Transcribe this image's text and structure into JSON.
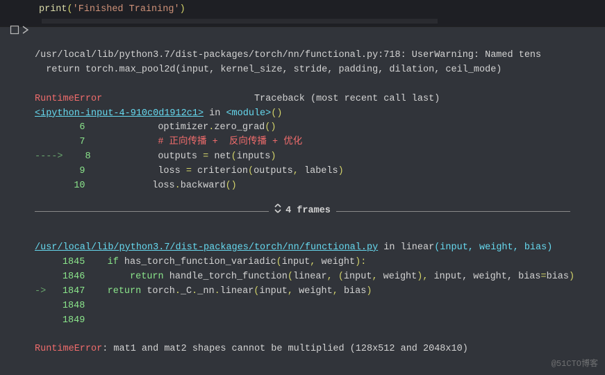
{
  "input_cell": {
    "tokens": {
      "print": "print",
      "string": "'Finished  Training'"
    }
  },
  "output": {
    "warning_line": "/usr/local/lib/python3.7/dist-packages/torch/nn/functional.py:718: UserWarning: Named tens",
    "warning_return": "  return torch.max_pool2d(input, kernel_size, stride, padding, dilation, ceil_mode)",
    "runtime_error_label": "RuntimeError",
    "traceback_label": "                           Traceback (most recent call last)",
    "ipython_link": "<ipython-input-4-910c0d1912c1>",
    "in_module": " in ",
    "module_angle": "<module>",
    "paren_empty": "()",
    "lines_block1": [
      {
        "ln": "6",
        "arrow": "     ",
        "tokens": [
          {
            "cls": "plain",
            "t": "        optimizer"
          },
          {
            "cls": "yellow",
            "t": "."
          },
          {
            "cls": "plain",
            "t": "zero_grad"
          },
          {
            "cls": "yellow",
            "t": "()"
          }
        ]
      },
      {
        "ln": "7",
        "arrow": "     ",
        "tokens": [
          {
            "cls": "plain",
            "t": "        "
          },
          {
            "cls": "red",
            "t": "# 正向传播 +  反向传播 + 优化"
          }
        ]
      },
      {
        "ln": "8",
        "arrow": "----> ",
        "tokens": [
          {
            "cls": "plain",
            "t": "       outputs "
          },
          {
            "cls": "yellow",
            "t": "="
          },
          {
            "cls": "plain",
            "t": " net"
          },
          {
            "cls": "yellow",
            "t": "("
          },
          {
            "cls": "plain",
            "t": "inputs"
          },
          {
            "cls": "yellow",
            "t": ")"
          }
        ]
      },
      {
        "ln": "9",
        "arrow": "     ",
        "tokens": [
          {
            "cls": "plain",
            "t": "        loss "
          },
          {
            "cls": "yellow",
            "t": "="
          },
          {
            "cls": "plain",
            "t": " criterion"
          },
          {
            "cls": "yellow",
            "t": "("
          },
          {
            "cls": "plain",
            "t": "outputs"
          },
          {
            "cls": "yellow",
            "t": ","
          },
          {
            "cls": "plain",
            "t": " labels"
          },
          {
            "cls": "yellow",
            "t": ")"
          }
        ]
      },
      {
        "ln": "10",
        "arrow": "     ",
        "tokens": [
          {
            "cls": "plain",
            "t": "       loss"
          },
          {
            "cls": "yellow",
            "t": "."
          },
          {
            "cls": "plain",
            "t": "backward"
          },
          {
            "cls": "yellow",
            "t": "()"
          }
        ]
      }
    ],
    "frames_sep": "4 frames",
    "functional_link": "/usr/local/lib/python3.7/dist-packages/torch/nn/functional.py",
    "in_linear": " in linear",
    "linear_args": "(input, weight, bias)",
    "lines_block2": [
      {
        "ln": "1845",
        "arrow": "   ",
        "tokens": [
          {
            "cls": "plain",
            "t": "   "
          },
          {
            "cls": "green",
            "t": "if"
          },
          {
            "cls": "plain",
            "t": " has_torch_function_variadic"
          },
          {
            "cls": "yellow",
            "t": "("
          },
          {
            "cls": "plain",
            "t": "input"
          },
          {
            "cls": "yellow",
            "t": ","
          },
          {
            "cls": "plain",
            "t": " weight"
          },
          {
            "cls": "yellow",
            "t": "):"
          }
        ]
      },
      {
        "ln": "1846",
        "arrow": "   ",
        "tokens": [
          {
            "cls": "plain",
            "t": "       "
          },
          {
            "cls": "green",
            "t": "return"
          },
          {
            "cls": "plain",
            "t": " handle_torch_function"
          },
          {
            "cls": "yellow",
            "t": "("
          },
          {
            "cls": "plain",
            "t": "linear"
          },
          {
            "cls": "yellow",
            "t": ","
          },
          {
            "cls": "plain",
            "t": " "
          },
          {
            "cls": "yellow",
            "t": "("
          },
          {
            "cls": "plain",
            "t": "input"
          },
          {
            "cls": "yellow",
            "t": ","
          },
          {
            "cls": "plain",
            "t": " weight"
          },
          {
            "cls": "yellow",
            "t": "),"
          },
          {
            "cls": "plain",
            "t": " input, weight, bias"
          },
          {
            "cls": "yellow",
            "t": "="
          },
          {
            "cls": "plain",
            "t": "bias"
          },
          {
            "cls": "yellow",
            "t": ")"
          }
        ]
      },
      {
        "ln": "1847",
        "arrow": "-> ",
        "tokens": [
          {
            "cls": "plain",
            "t": "   "
          },
          {
            "cls": "green",
            "t": "return"
          },
          {
            "cls": "plain",
            "t": " torch"
          },
          {
            "cls": "yellow",
            "t": "."
          },
          {
            "cls": "plain",
            "t": "_C"
          },
          {
            "cls": "yellow",
            "t": "."
          },
          {
            "cls": "plain",
            "t": "_nn"
          },
          {
            "cls": "yellow",
            "t": "."
          },
          {
            "cls": "plain",
            "t": "linear"
          },
          {
            "cls": "yellow",
            "t": "("
          },
          {
            "cls": "plain",
            "t": "input"
          },
          {
            "cls": "yellow",
            "t": ","
          },
          {
            "cls": "plain",
            "t": " weight"
          },
          {
            "cls": "yellow",
            "t": ","
          },
          {
            "cls": "plain",
            "t": " bias"
          },
          {
            "cls": "yellow",
            "t": ")"
          }
        ]
      },
      {
        "ln": "1848",
        "arrow": "   ",
        "tokens": []
      },
      {
        "ln": "1849",
        "arrow": "   ",
        "tokens": []
      }
    ],
    "final_error_label": "RuntimeError",
    "final_error_msg": ": mat1 and mat2 shapes cannot be multiplied (128x512 and 2048x10)"
  },
  "watermark": "@51CTO博客"
}
